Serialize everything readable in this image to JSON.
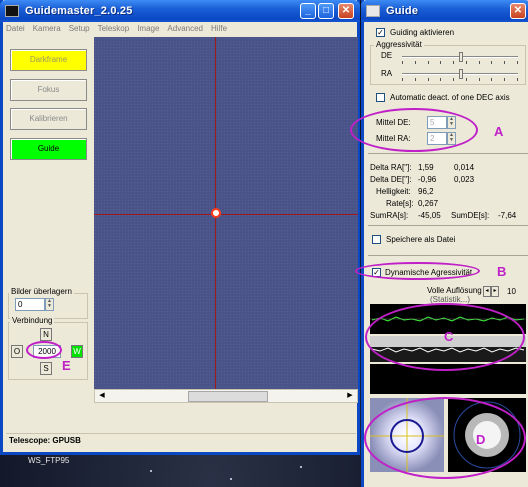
{
  "desktop": {
    "caption": "WS_FTP95"
  },
  "main_window": {
    "title": "Guidemaster_2.0.25",
    "menu": [
      "Datei",
      "Kamera",
      "Setup",
      "Teleskop",
      "Image",
      "Advanced",
      "Hilfe"
    ],
    "buttons": {
      "darkframe": "Darkframe",
      "fokus": "Fokus",
      "kalibrieren": "Kalibrieren",
      "guide": "Guide"
    },
    "overlay": {
      "label": "Bilder überlagern",
      "value": "0"
    },
    "connection": {
      "label": "Verbindung",
      "north": "N",
      "south": "S",
      "east": "O",
      "west": "W",
      "duration": "2000"
    },
    "status": "Telescope: GPUSB"
  },
  "guide_window": {
    "title": "Guide",
    "guiding_active_label": "Guiding aktivieren",
    "aggressiveness_label": "Aggressivität",
    "de_label": "DE",
    "ra_label": "RA",
    "auto_deact_label": "Automatic deact. of one DEC axis",
    "mittel_de_label": "Mittel DE:",
    "mittel_de_value": "5",
    "mittel_ra_label": "Mittel RA:",
    "mittel_ra_value": "2",
    "delta_ra_label": "Delta RA[\"]:",
    "delta_ra_values": [
      "1,59",
      "0,014"
    ],
    "delta_de_label": "Delta DE[\"]:",
    "delta_de_values": [
      "-0,96",
      "0,023"
    ],
    "helligkeit_label": "Helligkeit:",
    "helligkeit_value": "96,2",
    "rate_label": "Rate[s]:",
    "rate_value": "0,267",
    "sumra_label": "SumRA[s]:",
    "sumra_value": "-45,05",
    "sumde_label": "SumDE[s]:",
    "sumde_value": "-7,64",
    "save_label": "Speichere als Datei",
    "dynamic_label": "Dynamische Agressivität",
    "resolution_label": "Volle Auflösung",
    "resolution_sub": "(Statistik...)",
    "resolution_value": "10"
  },
  "annotations": {
    "a": "A",
    "b": "B",
    "c": "C",
    "d": "D",
    "e": "E"
  },
  "colors": {
    "xp_blue": "#0b48c4",
    "button_yellow": "#ffff00",
    "button_green": "#00ff00",
    "annotation": "#c020c8",
    "crosshair": "#a01818"
  },
  "icons": {
    "minimize": "minimize-icon",
    "maximize": "maximize-icon",
    "close": "close-icon"
  }
}
